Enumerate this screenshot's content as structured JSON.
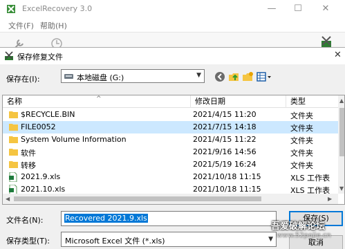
{
  "app": {
    "title": "ExcelRecovery 3.0",
    "menu": [
      "文件(F)",
      "帮助(H)"
    ],
    "controls": {
      "minimize": "—",
      "maximize": "☐",
      "close": "✕"
    }
  },
  "dialog": {
    "title": "保存修复文件",
    "close": "✕",
    "save_in_label": "保存在(I):",
    "save_in_value": "本地磁盘 (G:)",
    "columns": [
      "名称",
      "修改日期",
      "类型"
    ],
    "rows": [
      {
        "name": "$RECYCLE.BIN",
        "date": "2021/4/15 11:20",
        "type": "文件夹",
        "icon": "folder-icon"
      },
      {
        "name": "FILE0052",
        "date": "2021/7/15 14:18",
        "type": "文件夹",
        "icon": "folder-icon",
        "selected": true
      },
      {
        "name": "System Volume Information",
        "date": "2021/4/15 11:22",
        "type": "文件夹",
        "icon": "folder-icon"
      },
      {
        "name": "软件",
        "date": "2021/9/16 14:56",
        "type": "文件夹",
        "icon": "folder-icon"
      },
      {
        "name": "转移",
        "date": "2021/5/19 16:24",
        "type": "文件夹",
        "icon": "folder-icon"
      },
      {
        "name": "2021.9.xls",
        "date": "2021/10/18 11:15",
        "type": "XLS 工作表",
        "icon": "excel-file-icon"
      },
      {
        "name": "2021.10.xls",
        "date": "2021/10/18 11:15",
        "type": "XLS 工作表",
        "icon": "excel-file-icon"
      }
    ],
    "filename_label": "文件名(N):",
    "filename_value": "Recovered 2021.9.xls",
    "filetype_label": "保存类型(T):",
    "filetype_value": "Microsoft Excel 文件 (*.xls)",
    "save_button": "保存(S)",
    "cancel_button": "取消"
  },
  "watermark": {
    "line1": "吾爱破解论坛",
    "line2": "www.52pojie.cn"
  },
  "colors": {
    "selection": "#cce8ff",
    "accent": "#0078d7",
    "folder": "#f5c542"
  }
}
